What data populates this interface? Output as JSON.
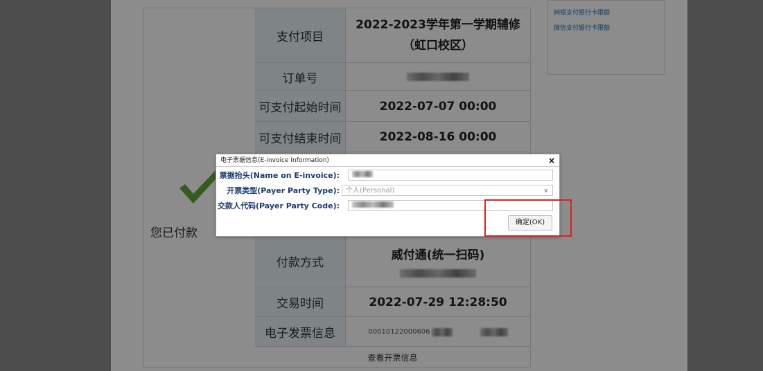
{
  "table": {
    "paid_label": "您已付款",
    "rows": [
      {
        "label": "支付项目",
        "value": "2022-2023学年第一学期辅修（虹口校区）"
      },
      {
        "label": "订单号",
        "value": ""
      },
      {
        "label": "可支付起始时间",
        "value": "2022-07-07 00:00"
      },
      {
        "label": "可支付结束时间",
        "value": "2022-08-16 00:00"
      },
      {
        "label": "付款方式",
        "value": "威付通(统一扫码)"
      },
      {
        "label": "交易时间",
        "value": "2022-07-29 12:28:50"
      },
      {
        "label": "电子发票信息",
        "value": "00010122000606"
      }
    ],
    "view_invoice": "查看开票信息"
  },
  "side_panel": {
    "links": [
      "网银支付银行卡限额",
      "微信支付银行卡限额"
    ]
  },
  "dialog": {
    "title": "电子票据信息(E-invoice Information)",
    "close": "×",
    "fields": [
      {
        "label": "票据抬头(Name on E-invoice):",
        "value": ""
      },
      {
        "label": "开票类型(Payer Party Type):",
        "value": "个人(Personal)"
      },
      {
        "label": "交款人代码(Payer Party Code):",
        "value": ""
      }
    ],
    "ok_label": "确定(OK)"
  },
  "icons": {
    "check": "check-icon",
    "dropdown": "chevron-down-icon"
  },
  "colors": {
    "accent": "#1a3a73",
    "highlight": "#e02020",
    "check": "#5fa83c"
  }
}
